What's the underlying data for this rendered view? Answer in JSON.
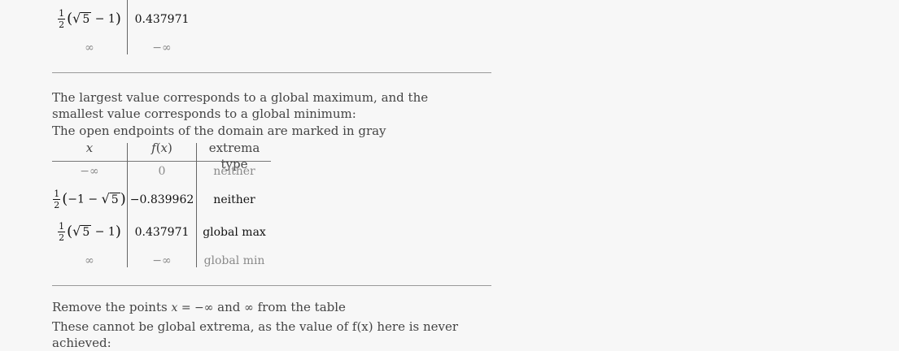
{
  "top_table": {
    "rows": [
      {
        "x": {
          "coef_num": "1",
          "coef_den": "2",
          "inner_pre": "",
          "sqrt_arg": "5",
          "inner_post": " − 1"
        },
        "f": "0.437971"
      },
      {
        "x_text": "∞",
        "f": "−∞"
      }
    ]
  },
  "paragraphs": {
    "p1": "The largest value corresponds to a global maximum, and the smallest value corresponds to a global minimum:",
    "p2": "The open endpoints of the domain are marked in gray",
    "p3_pre": "Remove the points ",
    "p3_math_x": "x",
    "p3_math_eq": " = −∞",
    "p3_mid": " and ",
    "p3_inf": "∞",
    "p3_post": " from the table",
    "p4": "These cannot be global extrema, as the value of f(x) here is never achieved:"
  },
  "extrema_table": {
    "headers": {
      "x": "x",
      "f_f": "f",
      "f_lp": "(",
      "f_x": "x",
      "f_rp": ")",
      "type": "extrema type"
    },
    "rows": [
      {
        "x_text": "−∞",
        "f": "0",
        "type": "neither",
        "muted": true
      },
      {
        "x": {
          "coef_num": "1",
          "coef_den": "2",
          "inner": "−1 − ",
          "sqrt_arg": "5"
        },
        "f": "−0.839962",
        "type": "neither",
        "muted": false
      },
      {
        "x": {
          "coef_num": "1",
          "coef_den": "2",
          "inner_pre": "",
          "sqrt_arg": "5",
          "inner_post": " − 1"
        },
        "f": "0.437971",
        "type": "global max",
        "muted": false
      },
      {
        "x_text": "∞",
        "f": "−∞",
        "type": "global min",
        "muted": true
      }
    ]
  },
  "colors": {
    "background": "#f7f7f7",
    "text": "#444444",
    "muted": "#8a8a8a",
    "rule": "#999999"
  }
}
